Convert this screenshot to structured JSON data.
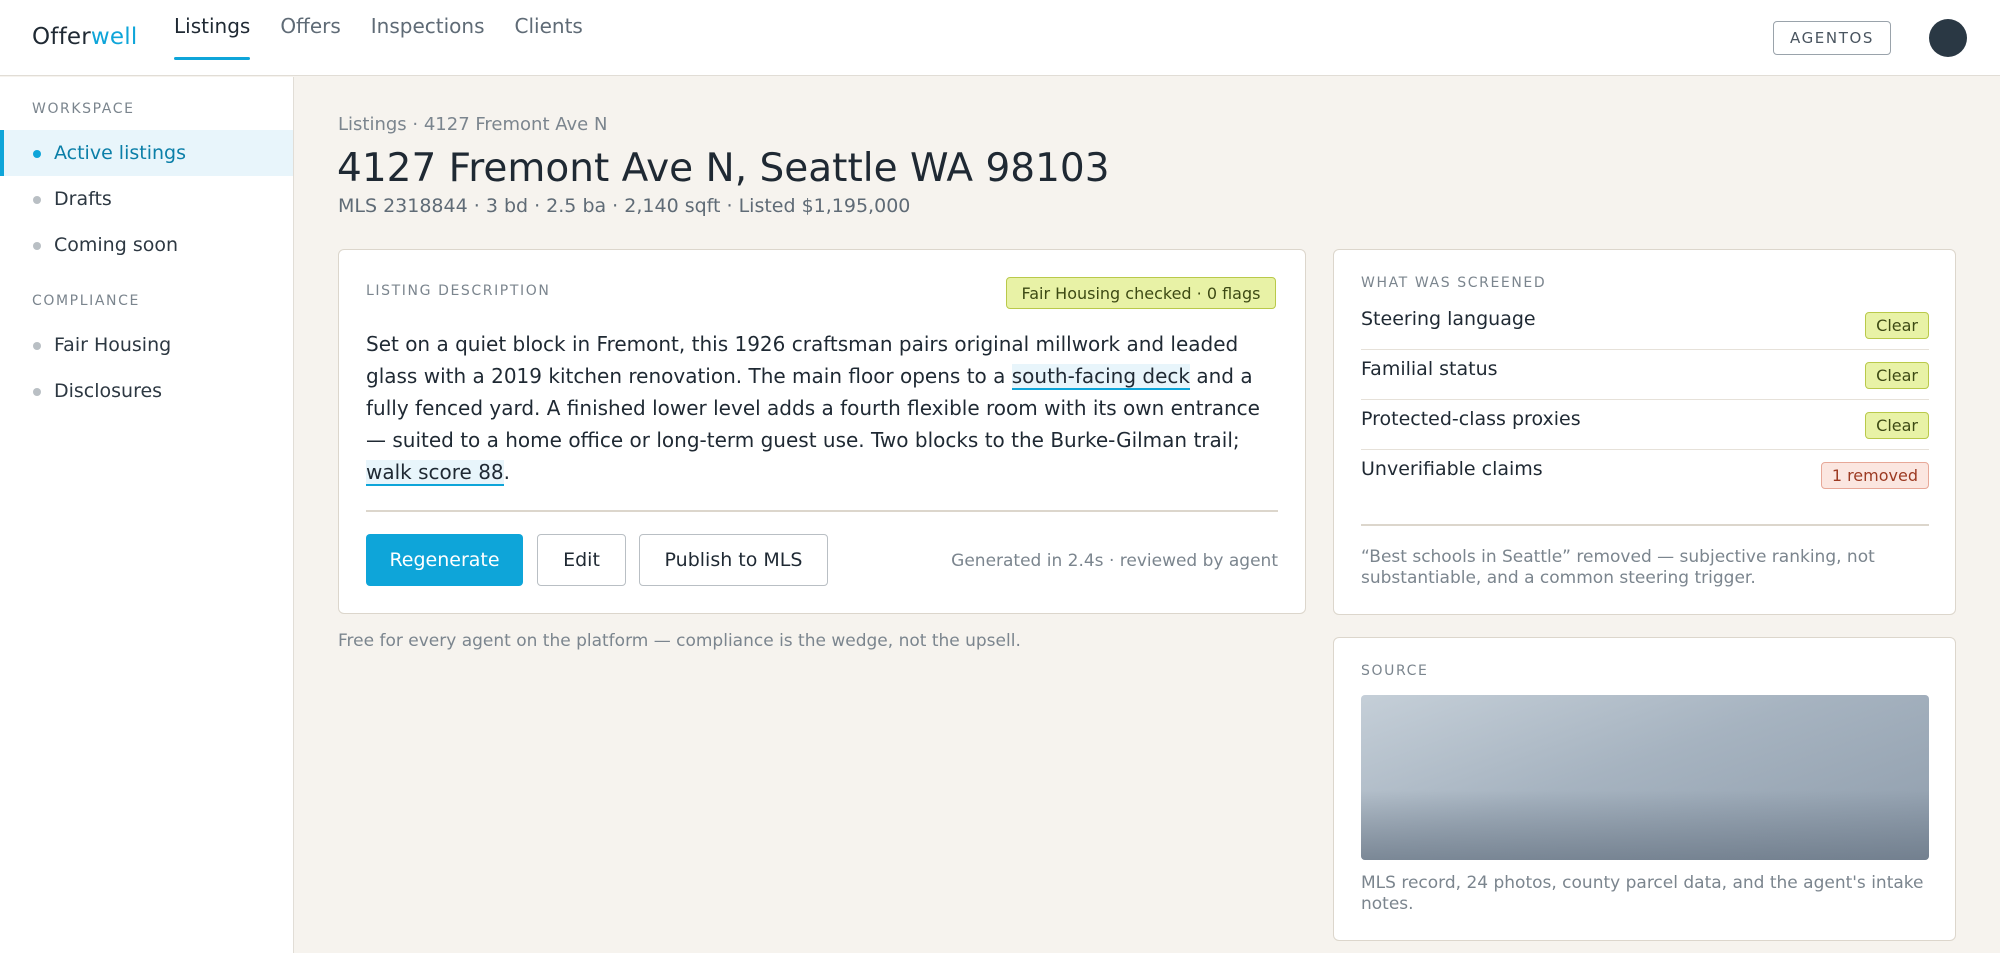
{
  "brand": {
    "prefix": "Offer",
    "accent": "well"
  },
  "nav": {
    "tabs": [
      {
        "label": "Listings",
        "active": true
      },
      {
        "label": "Offers"
      },
      {
        "label": "Inspections"
      },
      {
        "label": "Clients"
      }
    ],
    "agentos_label": "AGENTOS"
  },
  "sidebar": {
    "workspace_heading": "WORKSPACE",
    "workspace_items": [
      {
        "label": "Active listings",
        "active": true
      },
      {
        "label": "Drafts"
      },
      {
        "label": "Coming soon"
      }
    ],
    "compliance_heading": "COMPLIANCE",
    "compliance_items": [
      {
        "label": "Fair Housing"
      },
      {
        "label": "Disclosures"
      }
    ]
  },
  "page": {
    "breadcrumb": "Listings · 4127 Fremont Ave N",
    "title": "4127 Fremont Ave N, Seattle WA 98103",
    "subtitle": "MLS 2318844 · 3 bd · 2.5 ba · 2,140 sqft · Listed $1,195,000"
  },
  "description": {
    "label": "LISTING DESCRIPTION",
    "badge": "Fair Housing checked · 0 flags",
    "text_1": "Set on a quiet block in Fremont, this 1926 craftsman pairs original millwork and leaded glass with a 2019 kitchen renovation. The main floor opens to a ",
    "highlight_1": "south-facing deck",
    "text_2": " and a fully fenced yard. A finished lower level adds a fourth flexible room with its own entrance — suited to a home office or long-term guest use. Two blocks to the Burke-Gilman trail; ",
    "highlight_2": "walk score 88",
    "text_3": ".",
    "regenerate_label": "Regenerate",
    "edit_label": "Edit",
    "publish_label": "Publish to MLS",
    "meta": "Generated in 2.4s · reviewed by agent"
  },
  "footnote": "Free for every agent on the platform — compliance is the wedge, not the upsell.",
  "screened": {
    "label": "WHAT WAS SCREENED",
    "rows": [
      {
        "name": "Steering language",
        "status": "Clear"
      },
      {
        "name": "Familial status",
        "status": "Clear"
      },
      {
        "name": "Protected-class proxies",
        "status": "Clear"
      },
      {
        "name": "Unverifiable claims",
        "status": "1 removed"
      }
    ],
    "note": "“Best schools in Seattle” removed — subjective ranking, not substantiable, and a common steering trigger."
  },
  "source": {
    "label": "SOURCE",
    "text": "MLS record, 24 photos, county parcel data, and the agent's intake notes."
  },
  "colors": {
    "accent": "#0ea5d9",
    "clear_badge": "#e8f2a6",
    "removed_badge": "#fbe6e0",
    "background": "#f6f3ee"
  }
}
